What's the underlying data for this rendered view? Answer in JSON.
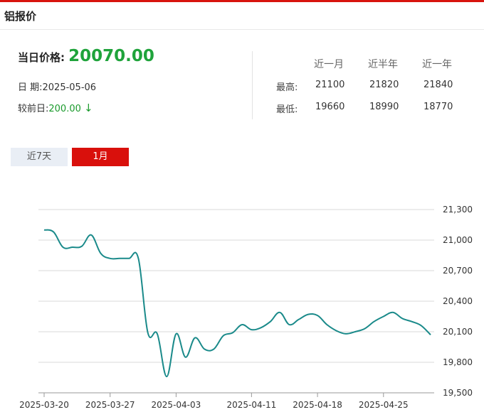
{
  "header": {
    "title": "铝报价"
  },
  "summary": {
    "price_label": "当日价格:",
    "price_value": "20070.00",
    "date_label": "日 期:",
    "date_value": "2025-05-06",
    "change_label": "较前日:",
    "change_value": "200.00",
    "change_arrow": "↓"
  },
  "stats": {
    "periods": [
      "近一月",
      "近半年",
      "近一年"
    ],
    "high_label": "最高:",
    "low_label": "最低:",
    "highs": [
      "21100",
      "21820",
      "21840"
    ],
    "lows": [
      "19660",
      "18990",
      "18770"
    ]
  },
  "tabs": [
    {
      "label": "近7天",
      "active": false
    },
    {
      "label": "1月",
      "active": true
    }
  ],
  "colors": {
    "line": "#1a8a8a",
    "accent_red": "#d9100c",
    "price_green": "#1fa33b"
  },
  "chart_data": {
    "type": "line",
    "title": "",
    "xlabel": "",
    "ylabel": "",
    "ylim": [
      19500,
      21300
    ],
    "y_ticks": [
      19500,
      19800,
      20100,
      20400,
      20700,
      21000,
      21300
    ],
    "y_tick_labels": [
      "19,500",
      "19,800",
      "20,100",
      "20,400",
      "20,700",
      "21,000",
      "21,300"
    ],
    "x_ticks": [
      "2025-03-20",
      "2025-03-27",
      "2025-04-03",
      "2025-04-11",
      "2025-04-18",
      "2025-04-25"
    ],
    "grid": true,
    "legend": "none",
    "series": [
      {
        "x": [
          "2025-03-20",
          "2025-03-21",
          "2025-03-22",
          "2025-03-23",
          "2025-03-24",
          "2025-03-25",
          "2025-03-26",
          "2025-03-27",
          "2025-03-28",
          "2025-03-29",
          "2025-03-30",
          "2025-03-31",
          "2025-04-01",
          "2025-04-02",
          "2025-04-03",
          "2025-04-04",
          "2025-04-05",
          "2025-04-06",
          "2025-04-07",
          "2025-04-08",
          "2025-04-09",
          "2025-04-10",
          "2025-04-11",
          "2025-04-12",
          "2025-04-13",
          "2025-04-14",
          "2025-04-15",
          "2025-04-16",
          "2025-04-17",
          "2025-04-18",
          "2025-04-19",
          "2025-04-20",
          "2025-04-21",
          "2025-04-22",
          "2025-04-23",
          "2025-04-24",
          "2025-04-25",
          "2025-04-26",
          "2025-04-27",
          "2025-04-28",
          "2025-04-29",
          "2025-04-30"
        ],
        "values": [
          21100,
          21080,
          20930,
          20930,
          20940,
          21050,
          20870,
          20820,
          20820,
          20820,
          20820,
          20090,
          20080,
          19660,
          20080,
          19850,
          20040,
          19930,
          19930,
          20060,
          20090,
          20170,
          20120,
          20140,
          20200,
          20290,
          20170,
          20220,
          20270,
          20260,
          20170,
          20110,
          20080,
          20100,
          20130,
          20200,
          20250,
          20290,
          20230,
          20200,
          20160,
          20070
        ]
      }
    ]
  }
}
